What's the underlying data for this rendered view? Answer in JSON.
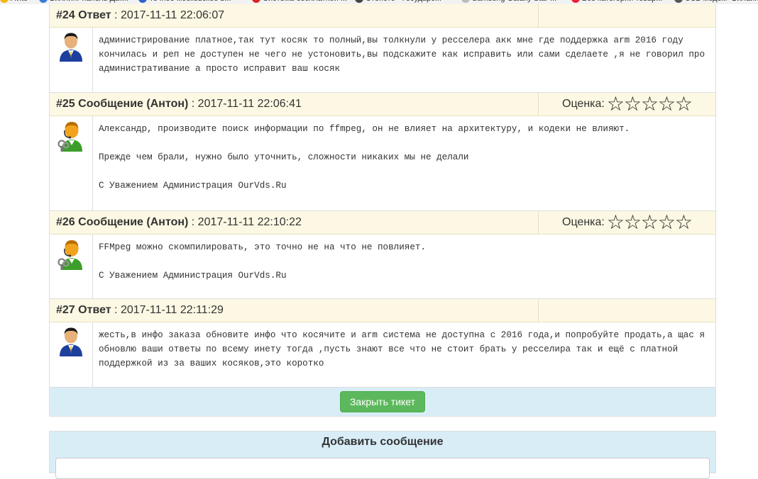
{
  "bookmarks": [
    {
      "label": "Avito",
      "icon": "avito-icon"
    },
    {
      "label": "Биллинг панель Дат...",
      "icon": "billing-icon"
    },
    {
      "label": "Точное московское в...",
      "icon": "clock-icon"
    },
    {
      "label": "Система бесплатной ...",
      "icon": "tb-icon"
    },
    {
      "label": "Стопото - Государс...",
      "icon": "lottery-icon"
    },
    {
      "label": "Samsung Galaxy Star ...",
      "icon": "page-icon"
    },
    {
      "label": "Все категории товар...",
      "icon": "shop-icon"
    },
    {
      "label": "USB модем \"Билайн\"...",
      "icon": "modem-icon"
    }
  ],
  "messages": [
    {
      "number": "#24",
      "kind": "Ответ",
      "author": "",
      "timestamp": "2017-11-11 22:06:07",
      "has_rating": false,
      "avatar": "user-avatar-icon",
      "paragraphs": [
        "администрирование платное,так тут косяк то полный,вы толкнули у ресселера акк мне где поддержка arm 2016 году кончилась и реп не доступен не чего не устоновить,вы подскажите как исправить или сами сделаете ,я не говорил про административание а просто исправит ваш косяк"
      ]
    },
    {
      "number": "#25",
      "kind": "Сообщение",
      "author": "(Антон)",
      "timestamp": "2017-11-11 22:06:41",
      "has_rating": true,
      "rating_label": "Оценка:",
      "rating_value": 0,
      "rating_max": 5,
      "avatar": "support-agent-avatar-icon",
      "paragraphs": [
        "Александр, производите поиск информации по ffmpeg, он не влияет на архитектуру, и кодеки не влияют.",
        "Прежде чем брали, нужно было уточнить, сложности никаких мы не делали",
        "С Уважением Администрация OurVds.Ru"
      ]
    },
    {
      "number": "#26",
      "kind": "Сообщение",
      "author": "(Антон)",
      "timestamp": "2017-11-11 22:10:22",
      "has_rating": true,
      "rating_label": "Оценка:",
      "rating_value": 0,
      "rating_max": 5,
      "avatar": "support-agent-avatar-icon",
      "paragraphs": [
        "FFMpeg можно скомпилировать, это точно не на что не повлияет.",
        "С Уважением Администрация OurVds.Ru"
      ]
    },
    {
      "number": "#27",
      "kind": "Ответ",
      "author": "",
      "timestamp": "2017-11-11 22:11:29",
      "has_rating": false,
      "avatar": "user-avatar-icon",
      "paragraphs": [
        "жесть,в инфо заказа обновите инфо что косячите и arm система не доступна с 2016 года,и попробуйте продать,а щас я обновлю ваши ответы по всему инету тогда ,пусть знают все что не стоит брать у ресселира так и ещё с платной поддержкой из за ваших косяков,это коротко"
      ]
    }
  ],
  "close_button_label": "Закрыть тикет",
  "add_message": {
    "heading": "Добавить сообщение"
  },
  "colors": {
    "header_bg": "#fcf8e3",
    "info_bg": "#d9edf7",
    "success_button": "#5cb85c",
    "user_avatar_shirt": "#1d3f9e",
    "agent_avatar_shirt": "#3c9e2a",
    "agent_avatar_face": "#f2a31b"
  }
}
